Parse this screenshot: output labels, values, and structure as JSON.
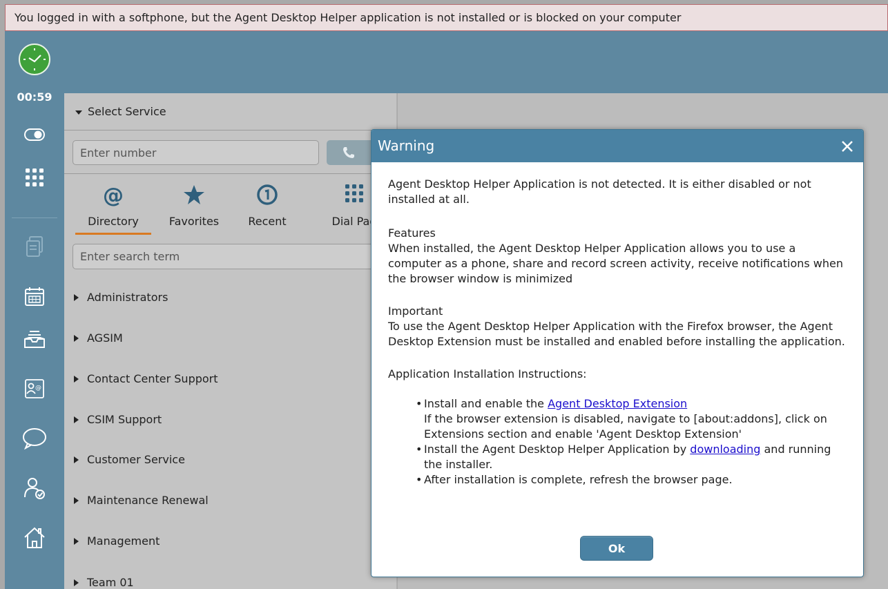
{
  "banner": {
    "text": "You logged in with a softphone, but the Agent Desktop Helper application is not installed or is blocked on your computer"
  },
  "sidebar": {
    "timer": "00:59",
    "icons": [
      "clock-icon",
      "toggle-icon",
      "dialpad-grid-icon",
      "document-icon",
      "calendar-icon",
      "inbox-icon",
      "contact-card-icon",
      "chat-bubble-icon",
      "user-check-icon",
      "home-icon"
    ]
  },
  "directory": {
    "select_service": "Select Service",
    "number_placeholder": "Enter number",
    "tabs": [
      {
        "label": "Directory",
        "icon": "at-icon",
        "active": true
      },
      {
        "label": "Favorites",
        "icon": "star-icon",
        "active": false
      },
      {
        "label": "Recent",
        "icon": "recent-icon",
        "active": false
      },
      {
        "label": "Dial Pad",
        "icon": "dialpad-icon",
        "active": false
      }
    ],
    "search_placeholder": "Enter search term",
    "groups": [
      "Administrators",
      "AGSIM",
      "Contact Center Support",
      "CSIM Support",
      "Customer Service",
      "Maintenance Renewal",
      "Management",
      "Team 01"
    ]
  },
  "modal": {
    "title": "Warning",
    "intro": "Agent Desktop Helper Application is not detected. It is either disabled or not installed at all.",
    "features_title": "Features",
    "features_text": "When installed, the Agent Desktop Helper Application allows you to use a computer as a phone, share and record screen activity, receive notifications when the browser window is minimized",
    "important_title": "Important",
    "important_text": "To use the Agent Desktop Helper Application with the Firefox browser, the Agent Desktop Extension must be installed and enabled before installing the application.",
    "instructions_title": "Application Installation Instructions:",
    "step1_prefix": "Install and enable the ",
    "step1_link": "Agent Desktop Extension",
    "step1_note": "If the browser extension is disabled, navigate to [about:addons], click on Extensions section and enable 'Agent Desktop Extension'",
    "step2_prefix": "Install the Agent Desktop Helper Application by ",
    "step2_link": "downloading",
    "step2_suffix": " and running the installer.",
    "step3": "After installation is complete, refresh the browser page.",
    "ok_label": "Ok"
  },
  "colors": {
    "sidebar": "#5e88a0",
    "modal_header": "#4a82a3",
    "tab_underline": "#d97a22",
    "clock_green": "#3fa13a",
    "link": "#1a0dcc"
  }
}
